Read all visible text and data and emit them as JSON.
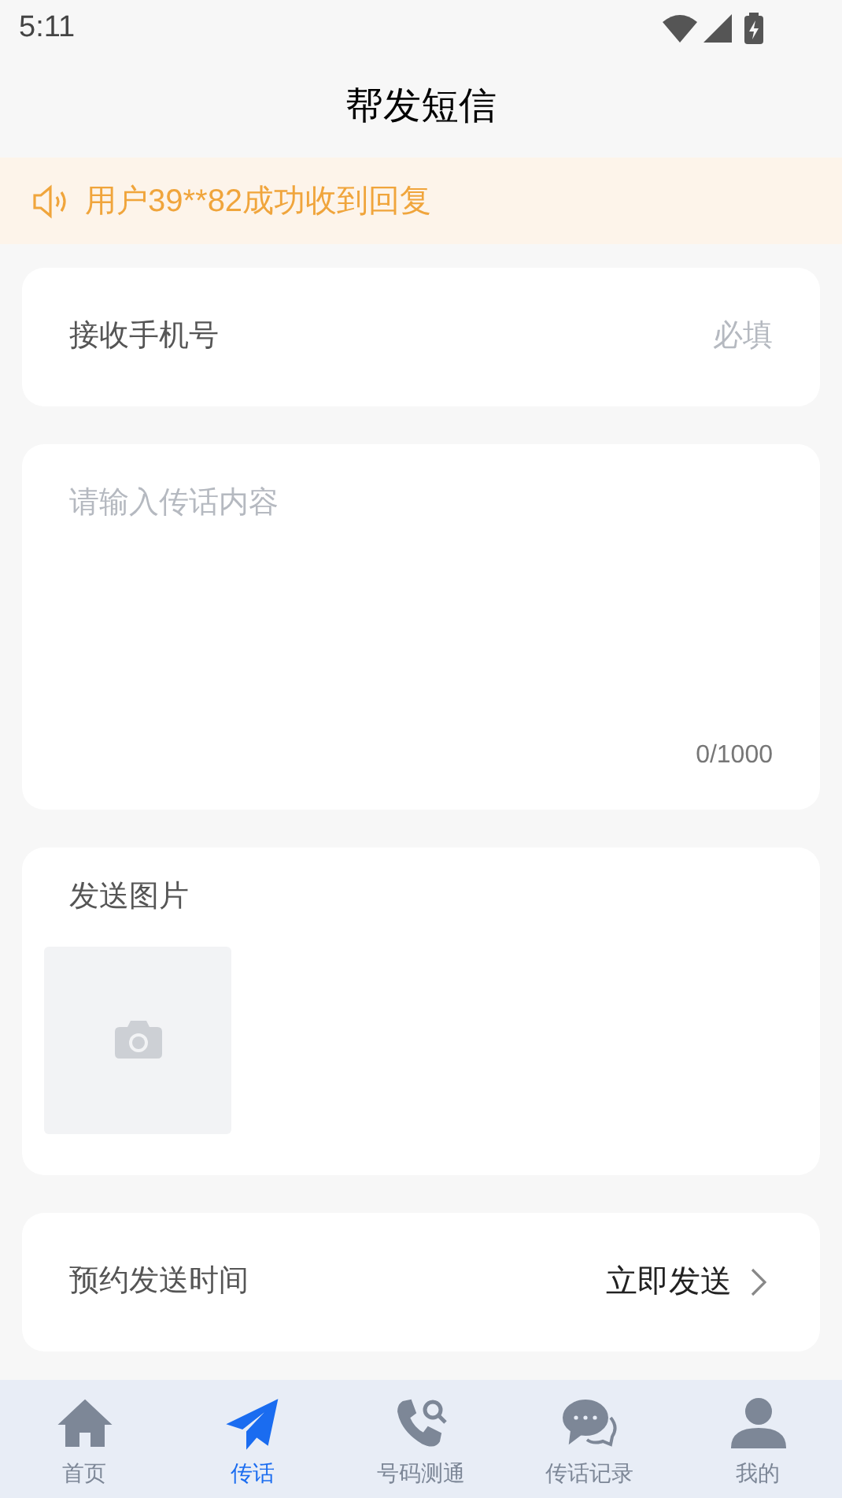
{
  "status_bar": {
    "time": "5:11"
  },
  "header": {
    "title": "帮发短信"
  },
  "notice": {
    "text": "用户39**82成功收到回复"
  },
  "phone_field": {
    "label": "接收手机号",
    "placeholder": "必填"
  },
  "message_field": {
    "placeholder": "请输入传话内容",
    "counter": "0/1000"
  },
  "image_section": {
    "label": "发送图片"
  },
  "schedule": {
    "label": "预约发送时间",
    "value": "立即发送"
  },
  "tab_bar": [
    {
      "kind": "home",
      "label": "首页",
      "selected": false
    },
    {
      "kind": "send",
      "label": "传话",
      "selected": true
    },
    {
      "kind": "phone",
      "label": "号码测通",
      "selected": false
    },
    {
      "kind": "chat",
      "label": "传话记录",
      "selected": false
    },
    {
      "kind": "user",
      "label": "我的",
      "selected": false
    }
  ]
}
